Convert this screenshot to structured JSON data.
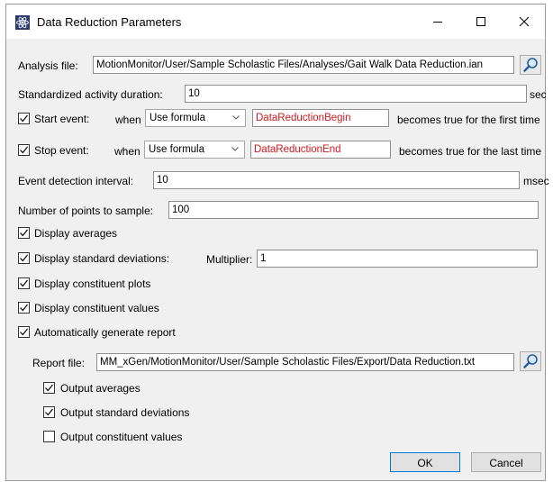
{
  "window": {
    "title": "Data Reduction Parameters",
    "icon": "atom-icon",
    "controls": [
      "minimize-icon",
      "maximize-icon",
      "close-icon"
    ]
  },
  "analysis_file": {
    "label": "Analysis file:",
    "value": "MotionMonitor/User/Sample Scholastic Files/Analyses/Gait Walk Data Reduction.ian",
    "browse_icon": "search-icon"
  },
  "duration": {
    "label": "Standardized activity duration:",
    "value": "10",
    "unit": "sec"
  },
  "start_event": {
    "checked": true,
    "label": "Start event:",
    "when": "when",
    "mode": "Use formula",
    "formula": "DataReductionBegin",
    "suffix": "becomes true for the first time"
  },
  "stop_event": {
    "checked": true,
    "label": "Stop event:",
    "when": "when",
    "mode": "Use formula",
    "formula": "DataReductionEnd",
    "suffix": "becomes true for the last time"
  },
  "detection_interval": {
    "label": "Event detection interval:",
    "value": "10",
    "unit": "msec"
  },
  "points": {
    "label": "Number of points to sample:",
    "value": "100"
  },
  "display_averages": {
    "label": "Display averages",
    "checked": true
  },
  "display_std": {
    "label": "Display standard deviations:",
    "checked": true,
    "multiplier_label": "Multiplier:",
    "multiplier": "1"
  },
  "display_constituent_plots": {
    "label": "Display constituent plots",
    "checked": true
  },
  "display_constituent_values": {
    "label": "Display constituent values",
    "checked": true
  },
  "auto_report": {
    "label": "Automatically generate report",
    "checked": true
  },
  "report_file": {
    "label": "Report file:",
    "value": "MM_xGen/MotionMonitor/User/Sample Scholastic Files/Export/Data Reduction.txt",
    "browse_icon": "search-icon"
  },
  "output_averages": {
    "label": "Output averages",
    "checked": true
  },
  "output_std": {
    "label": "Output standard deviations",
    "checked": true
  },
  "output_constituent": {
    "label": "Output constituent values",
    "checked": false
  },
  "buttons": {
    "ok": "OK",
    "cancel": "Cancel"
  }
}
